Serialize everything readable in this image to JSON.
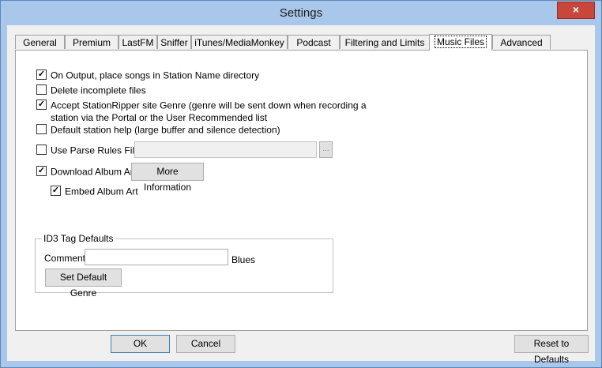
{
  "window": {
    "title": "Settings",
    "close_icon": "×"
  },
  "tabs": [
    {
      "label": "General"
    },
    {
      "label": "Premium"
    },
    {
      "label": "LastFM"
    },
    {
      "label": "Sniffer"
    },
    {
      "label": "iTunes/MediaMonkey"
    },
    {
      "label": "Podcast"
    },
    {
      "label": "Filtering and Limits"
    },
    {
      "label": "Music Files",
      "active": true
    },
    {
      "label": "Advanced"
    }
  ],
  "options": {
    "on_output": {
      "label": "On Output, place songs in Station Name directory",
      "checked": true
    },
    "delete_incomplete": {
      "label": "Delete incomplete files",
      "checked": false
    },
    "accept_genre": {
      "label_line1": "Accept StationRipper site Genre (genre will be sent down when recording a",
      "label_line2": "station via the Portal or the User Recommended list",
      "checked": true
    },
    "default_help": {
      "label": "Default station help (large buffer and silence detection)",
      "checked": false
    },
    "parse_rules": {
      "label": "Use Parse Rules File:",
      "checked": false,
      "value": "",
      "browse_label": "..."
    },
    "download_art": {
      "label": "Download Album Art",
      "checked": true,
      "more_info_label": "More Information"
    },
    "embed_art": {
      "label": "Embed Album Art",
      "checked": true
    }
  },
  "id3": {
    "group_title": "ID3 Tag Defaults",
    "comment_label": "Comment:",
    "comment_value": "",
    "genre_value": "Blues",
    "set_genre_label": "Set Default Genre"
  },
  "footer": {
    "ok_label": "OK",
    "cancel_label": "Cancel",
    "reset_label": "Reset to Defaults"
  }
}
